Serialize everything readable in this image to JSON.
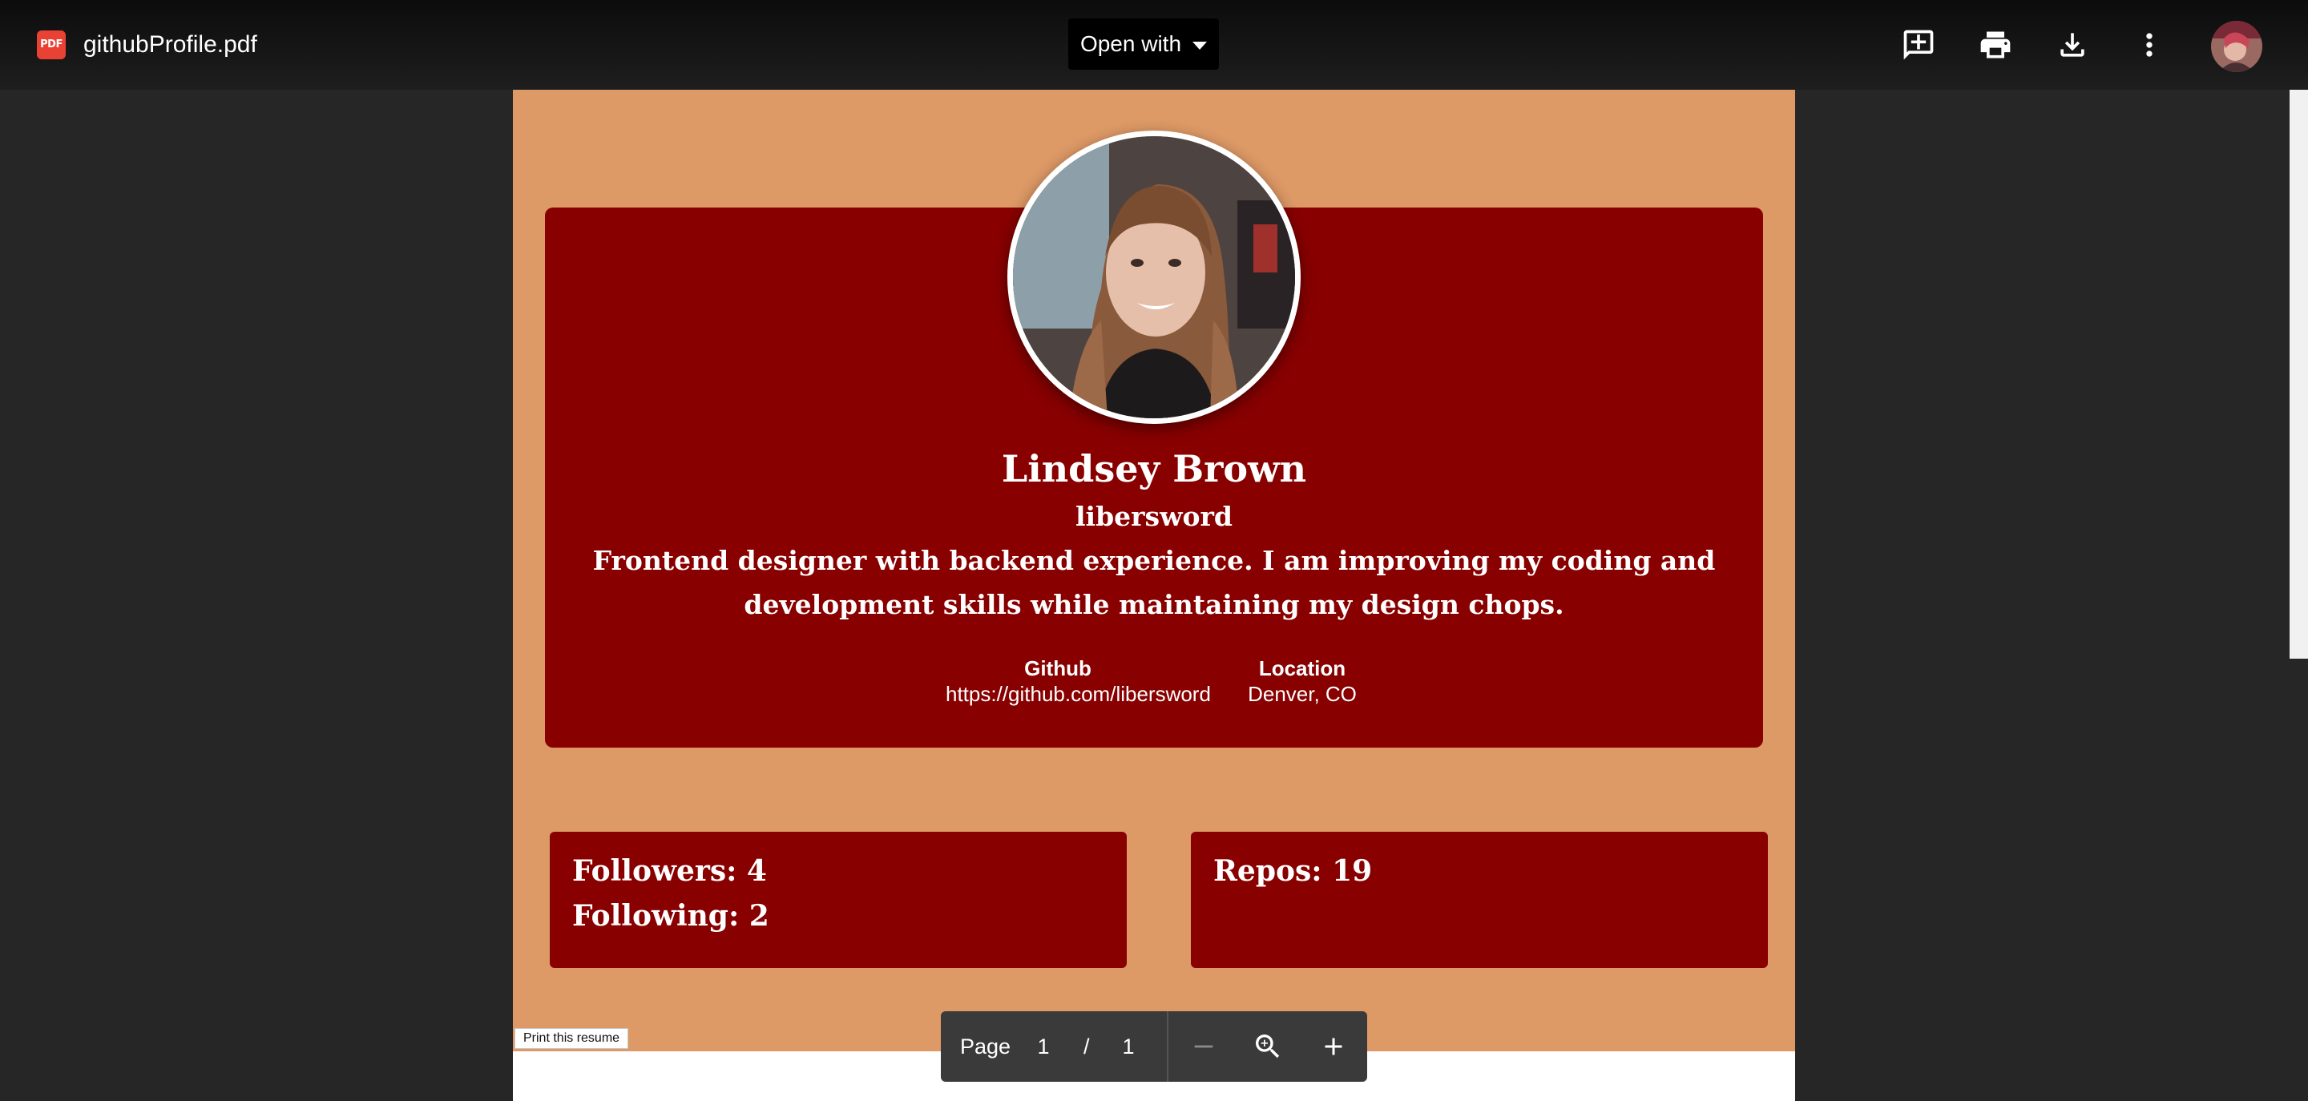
{
  "toolbar": {
    "file_icon_label": "PDF",
    "file_name": "githubProfile.pdf",
    "open_with_label": "Open with",
    "icons": [
      "add-comment-icon",
      "print-icon",
      "download-icon",
      "more-vert-icon",
      "account-avatar"
    ]
  },
  "profile": {
    "name": "Lindsey Brown",
    "username": "libersword",
    "bio": "Frontend designer with backend experience. I am improving my coding and development skills while maintaining my design chops.",
    "github_label": "Github",
    "github_url": "https://github.com/libersword",
    "location_label": "Location",
    "location": "Denver, CO"
  },
  "stats": {
    "followers": "Followers: 4",
    "following": "Following: 2",
    "repos": "Repos: 19"
  },
  "print_button_label": "Print this resume",
  "page_controls": {
    "label": "Page",
    "current": "1",
    "separator": "/",
    "total": "1"
  },
  "colors": {
    "page_background": "#dd9966",
    "card_background": "#880000",
    "viewer_background": "#262626",
    "pdf_icon": "#e94235"
  }
}
